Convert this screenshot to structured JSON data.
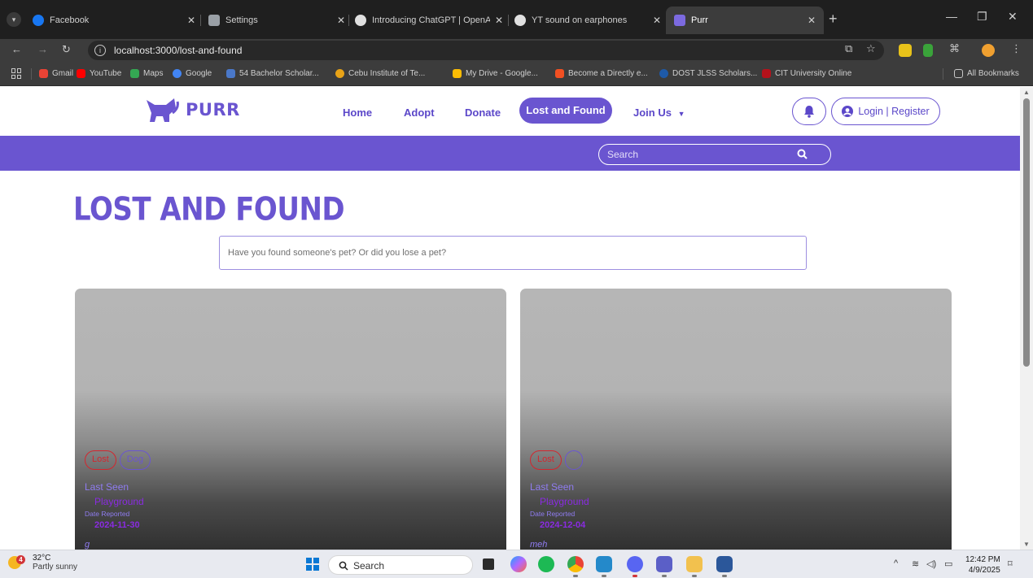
{
  "browser": {
    "tabs": [
      {
        "title": "Facebook",
        "icon": "facebook-icon",
        "color": "#1877f2"
      },
      {
        "title": "Settings",
        "icon": "gear-icon",
        "color": "#9aa0a6"
      },
      {
        "title": "Introducing ChatGPT | OpenAI",
        "icon": "openai-icon",
        "color": "#e0e0e0"
      },
      {
        "title": "YT sound on earphones",
        "icon": "openai-icon",
        "color": "#e0e0e0"
      },
      {
        "title": "Purr",
        "icon": "purr-cat-icon",
        "color": "#7c6ae0"
      }
    ],
    "active_tab_index": 4,
    "url": "localhost:3000/lost-and-found",
    "bookmarks": [
      {
        "label": "Gmail",
        "color": "#ea4335"
      },
      {
        "label": "YouTube",
        "color": "#ff0000"
      },
      {
        "label": "Maps",
        "color": "#34a853"
      },
      {
        "label": "Google",
        "color": "#4285f4"
      },
      {
        "label": "54 Bachelor Scholar...",
        "color": "#4a78c9"
      },
      {
        "label": "Cebu Institute of Te...",
        "color": "#e8a317"
      },
      {
        "label": "My Drive - Google...",
        "color": "#fbbc04"
      },
      {
        "label": "Become a Directly e...",
        "color": "#f25022"
      },
      {
        "label": "DOST JLSS Scholars...",
        "color": "#1e5aa8"
      },
      {
        "label": "CIT University Online",
        "color": "#b5121b"
      }
    ],
    "all_bookmarks_label": "All Bookmarks"
  },
  "site": {
    "brand": "PURR",
    "nav": {
      "home": "Home",
      "adopt": "Adopt",
      "donate": "Donate",
      "lost_found": "Lost and Found",
      "join_us": "Join Us"
    },
    "login_label": "Login | Register",
    "search_placeholder": "Search",
    "page_title": "LOST AND FOUND",
    "post_placeholder": "Have you found someone's pet? Or did you lose a pet?",
    "accent_color": "#6a55d0"
  },
  "cards": [
    {
      "status": "Lost",
      "type": "Dog",
      "last_seen_label": "Last Seen",
      "place": "Playground",
      "date_label": "Date Reported",
      "date": "2024-11-30",
      "description": "g"
    },
    {
      "status": "Lost",
      "type": "",
      "last_seen_label": "Last Seen",
      "place": "Playground",
      "date_label": "Date Reported",
      "date": "2024-12-04",
      "description": "meh"
    }
  ],
  "taskbar": {
    "temperature": "32°C",
    "condition": "Partly sunny",
    "weather_badge": "4",
    "search_label": "Search",
    "time": "12:42 PM",
    "date": "4/9/2025"
  }
}
